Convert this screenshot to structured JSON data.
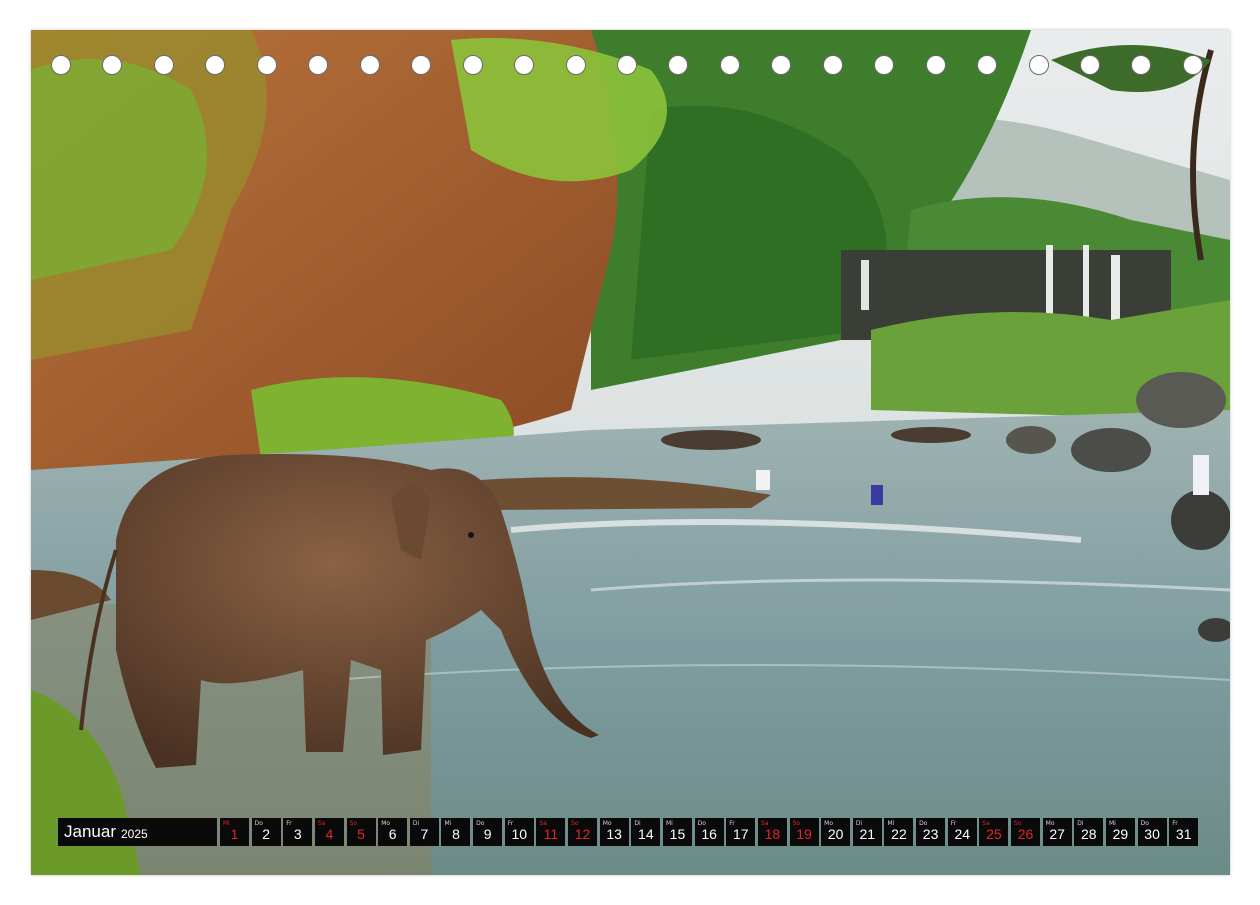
{
  "calendar": {
    "month": "Januar",
    "year": "2025",
    "days": [
      {
        "wd": "Mi",
        "num": "1",
        "red": true
      },
      {
        "wd": "Do",
        "num": "2",
        "red": false
      },
      {
        "wd": "Fr",
        "num": "3",
        "red": false
      },
      {
        "wd": "Sa",
        "num": "4",
        "red": true
      },
      {
        "wd": "So",
        "num": "5",
        "red": true
      },
      {
        "wd": "Mo",
        "num": "6",
        "red": false
      },
      {
        "wd": "Di",
        "num": "7",
        "red": false
      },
      {
        "wd": "Mi",
        "num": "8",
        "red": false
      },
      {
        "wd": "Do",
        "num": "9",
        "red": false
      },
      {
        "wd": "Fr",
        "num": "10",
        "red": false
      },
      {
        "wd": "Sa",
        "num": "11",
        "red": true
      },
      {
        "wd": "So",
        "num": "12",
        "red": true
      },
      {
        "wd": "Mo",
        "num": "13",
        "red": false
      },
      {
        "wd": "Di",
        "num": "14",
        "red": false
      },
      {
        "wd": "Mi",
        "num": "15",
        "red": false
      },
      {
        "wd": "Do",
        "num": "16",
        "red": false
      },
      {
        "wd": "Fr",
        "num": "17",
        "red": false
      },
      {
        "wd": "Sa",
        "num": "18",
        "red": true
      },
      {
        "wd": "So",
        "num": "19",
        "red": true
      },
      {
        "wd": "Mo",
        "num": "20",
        "red": false
      },
      {
        "wd": "Di",
        "num": "21",
        "red": false
      },
      {
        "wd": "Mi",
        "num": "22",
        "red": false
      },
      {
        "wd": "Do",
        "num": "23",
        "red": false
      },
      {
        "wd": "Fr",
        "num": "24",
        "red": false
      },
      {
        "wd": "Sa",
        "num": "25",
        "red": true
      },
      {
        "wd": "So",
        "num": "26",
        "red": true
      },
      {
        "wd": "Mo",
        "num": "27",
        "red": false
      },
      {
        "wd": "Di",
        "num": "28",
        "red": false
      },
      {
        "wd": "Mi",
        "num": "29",
        "red": false
      },
      {
        "wd": "Do",
        "num": "30",
        "red": false
      },
      {
        "wd": "Fr",
        "num": "31",
        "red": false
      }
    ]
  },
  "binding_holes": 23,
  "colors": {
    "calendar_bg": "#0a0a0a",
    "weekend_red": "#e0262b",
    "weekday_text": "#ffffff"
  }
}
